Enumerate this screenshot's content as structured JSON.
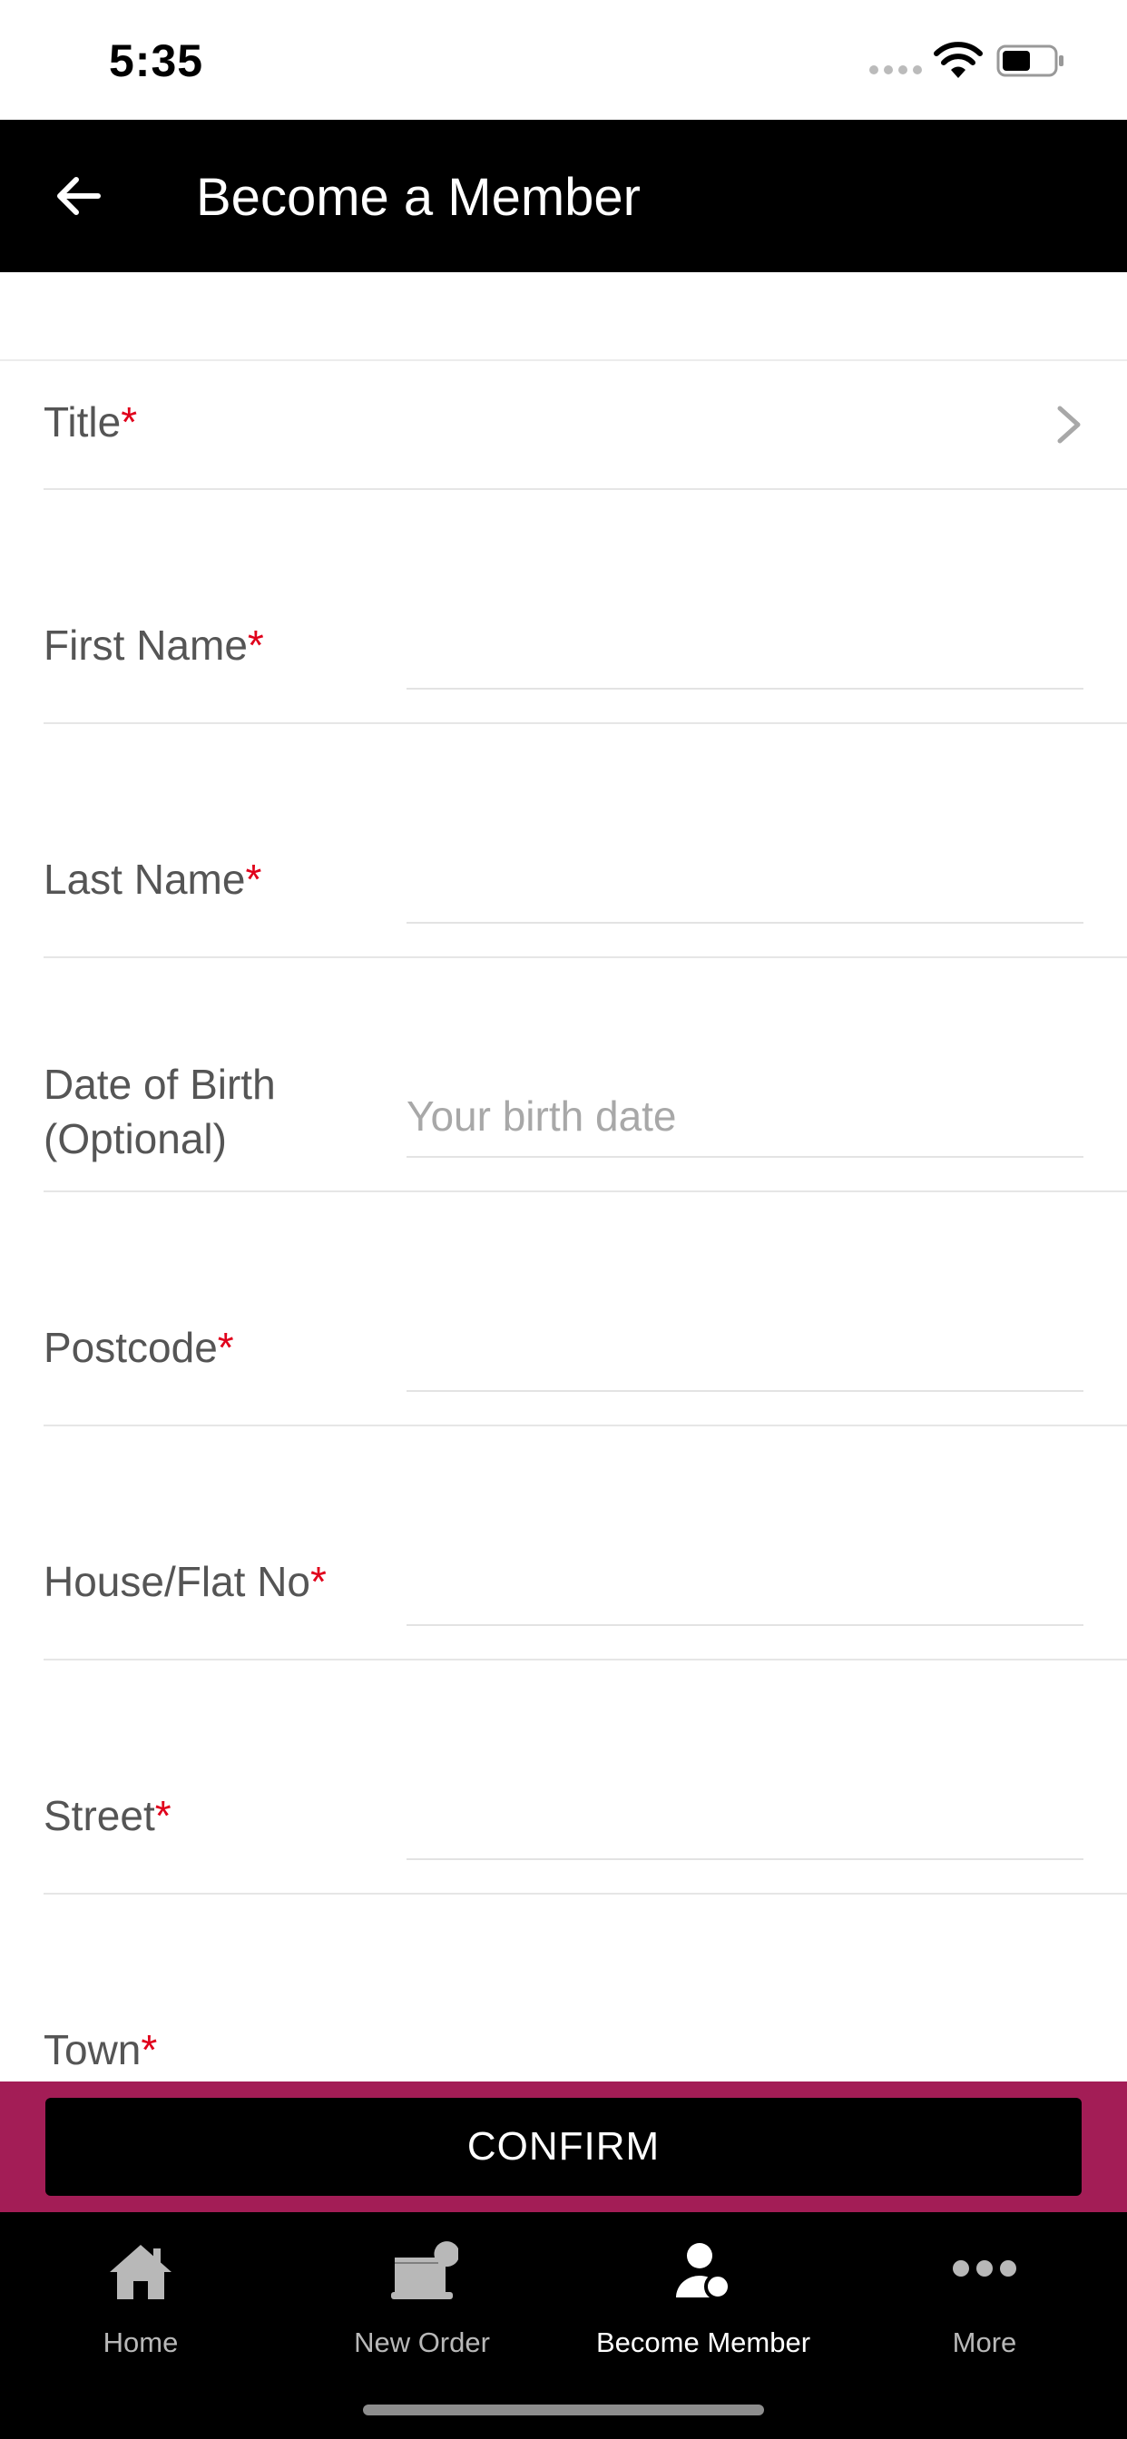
{
  "status_bar": {
    "time": "5:35"
  },
  "header": {
    "title": "Become a Member"
  },
  "form": {
    "required_mark": "*",
    "title_label": "Title",
    "first_name_label": "First Name",
    "last_name_label": "Last Name",
    "dob_label_line1": "Date of Birth",
    "dob_label_line2": "(Optional)",
    "dob_placeholder": "Your birth date",
    "postcode_label": "Postcode",
    "house_label": "House/Flat No",
    "street_label": "Street",
    "town_label": "Town"
  },
  "confirm": {
    "label": "CONFIRM"
  },
  "nav": {
    "items": [
      {
        "label": "Home",
        "icon": "home-icon"
      },
      {
        "label": "New Order",
        "icon": "new-order-icon"
      },
      {
        "label": "Become Member",
        "icon": "member-icon"
      },
      {
        "label": "More",
        "icon": "more-icon"
      }
    ],
    "active_index": 2
  },
  "colors": {
    "header_bg": "#000000",
    "accent": "#a31d56",
    "required": "#e0001b"
  }
}
